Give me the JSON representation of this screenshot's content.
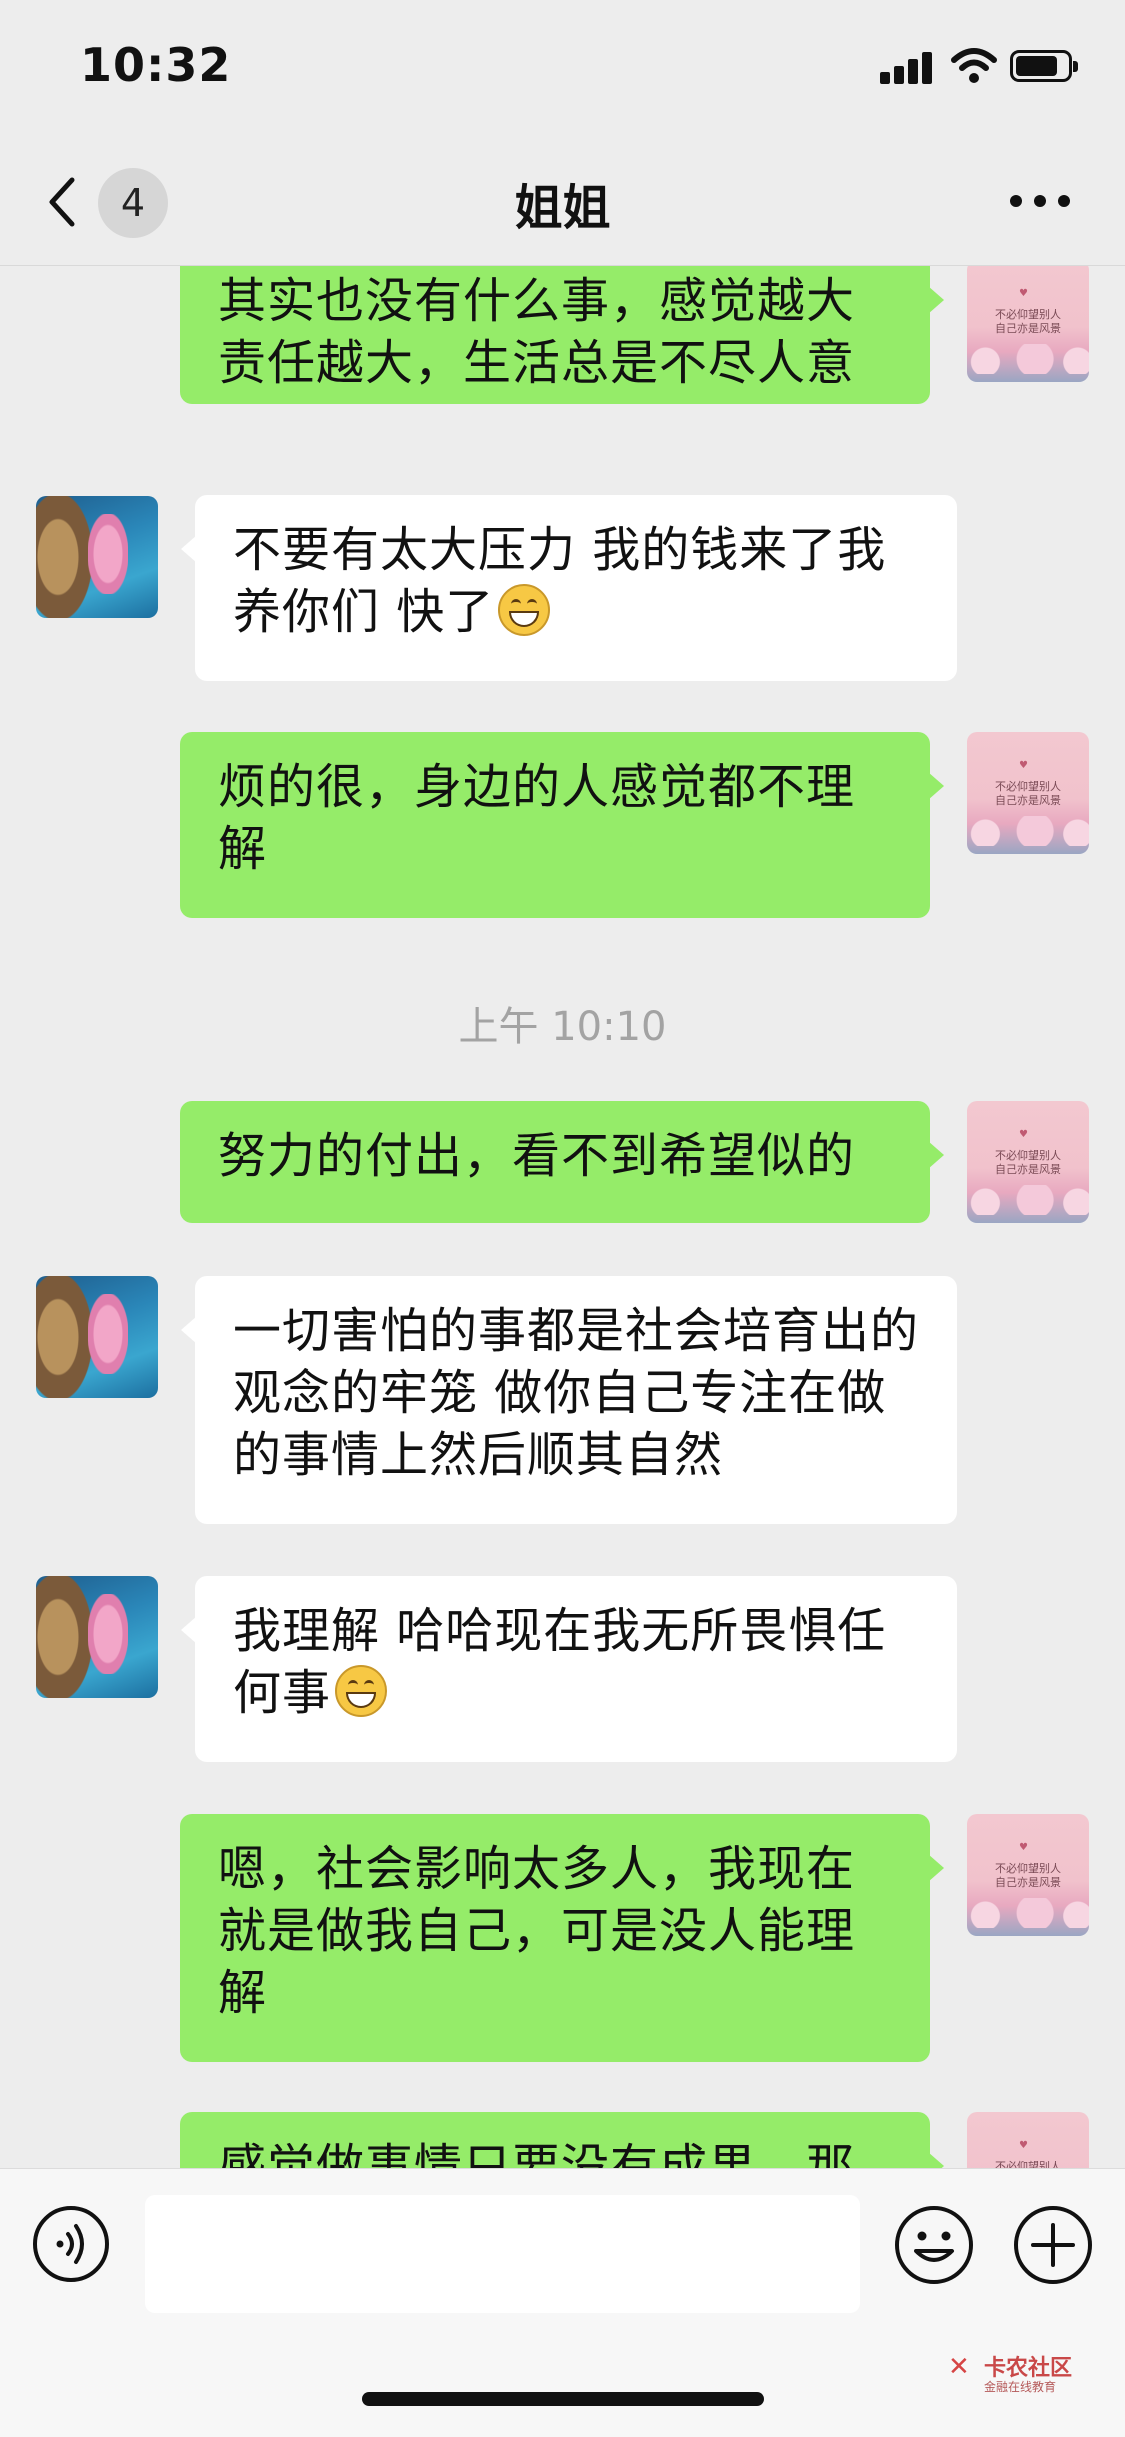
{
  "status_bar": {
    "time": "10:32"
  },
  "nav": {
    "unread_count": "4",
    "title": "姐姐"
  },
  "messages": [
    {
      "from": "self",
      "text": "其实也没有什么事，感觉越大责任越大，生活总是不尽人意"
    },
    {
      "from": "other",
      "text": "不要有太大压力 我的钱来了我养你们 快了",
      "emoji": "grin"
    },
    {
      "from": "self",
      "text": "烦的很，身边的人感觉都不理解"
    },
    {
      "type": "time",
      "text": "上午 10:10"
    },
    {
      "from": "self",
      "text": "努力的付出，看不到希望似的"
    },
    {
      "from": "other",
      "text": "一切害怕的事都是社会培育出的观念的牢笼 做你自己专注在做的事情上然后顺其自然"
    },
    {
      "from": "other",
      "text": "我理解 哈哈现在我无所畏惧任何事",
      "emoji": "grin"
    },
    {
      "from": "self",
      "text": "嗯，社会影响太多人，我现在就是做我自己，可是没人能理解"
    },
    {
      "from": "self",
      "text": "感觉做事情只要没有成果，那"
    }
  ],
  "self_avatar_caption": [
    "不必仰望别人",
    "自己亦是风景"
  ],
  "input": {
    "value": "",
    "placeholder": ""
  },
  "watermark": {
    "name": "卡农社区",
    "sub": "金融在线教育"
  },
  "icons": {
    "back": "chevron-left-icon",
    "more": "more-dots-icon",
    "voice": "voice-icon",
    "emoji": "emoji-icon",
    "plus": "plus-icon"
  },
  "colors": {
    "self_bubble": "#95ec69",
    "other_bubble": "#ffffff",
    "background": "#ededed"
  }
}
